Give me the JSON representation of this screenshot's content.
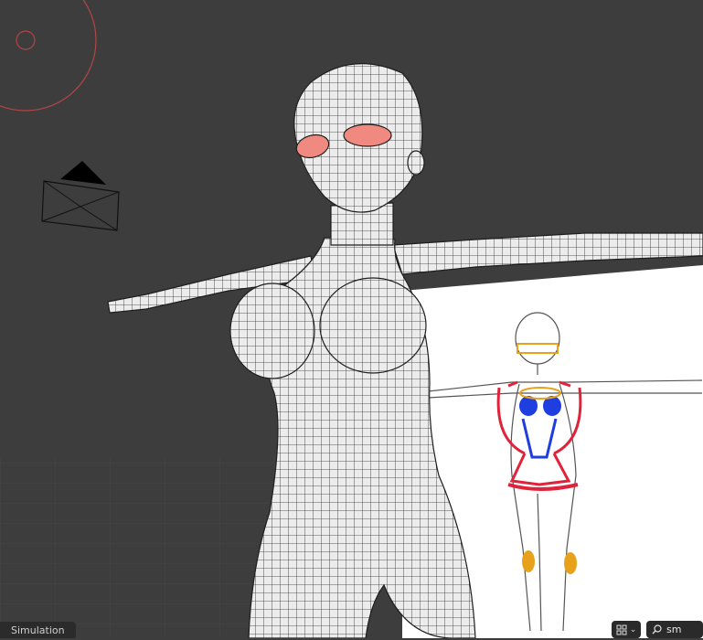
{
  "viewport": {
    "background_color": "#3d3d3d",
    "mesh_fill": "#eeeeee",
    "mesh_wire": "#222222",
    "eye_fill": "#f08a80",
    "light_color": "#c84a4a"
  },
  "status_bar": {
    "mode_label": "Simulation"
  },
  "header_tools": {
    "editor_type_icon": "grid-icon",
    "dropdown_icon": "chevron-down-icon",
    "search_icon": "search-icon",
    "search_value": "sm"
  },
  "reference_image": {
    "accent_colors": [
      "#e0233b",
      "#1f3ee0",
      "#e8a11a"
    ]
  }
}
